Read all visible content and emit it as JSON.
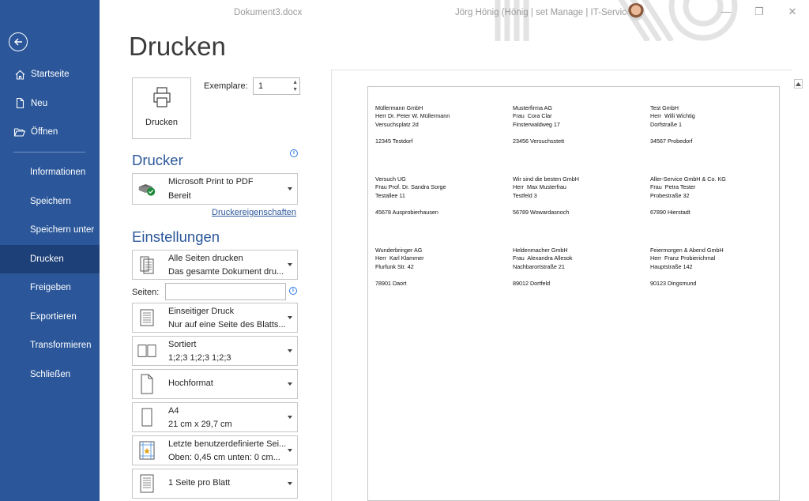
{
  "titlebar": {
    "document": "Dokument3.docx",
    "user": "Jörg Hönig (Hönig | set Manage | IT-Service)",
    "minimize": "—",
    "restore": "❐",
    "close": "✕"
  },
  "sidebar": {
    "top_items": [
      {
        "label": "Startseite",
        "icon": "home-icon"
      },
      {
        "label": "Neu",
        "icon": "new-document-icon"
      },
      {
        "label": "Öffnen",
        "icon": "folder-open-icon"
      }
    ],
    "bottom_items": [
      {
        "label": "Informationen"
      },
      {
        "label": "Speichern"
      },
      {
        "label": "Speichern unter"
      },
      {
        "label": "Drucken",
        "active": true
      },
      {
        "label": "Freigeben"
      },
      {
        "label": "Exportieren"
      },
      {
        "label": "Transformieren"
      },
      {
        "label": "Schließen"
      }
    ]
  },
  "print": {
    "title": "Drucken",
    "button_label": "Drucken",
    "copies_label": "Exemplare:",
    "copies_value": "1",
    "printer_heading": "Drucker",
    "printer_name": "Microsoft Print to PDF",
    "printer_status": "Bereit",
    "printer_properties": "Druckereigenschaften",
    "settings_heading": "Einstellungen",
    "pages_label": "Seiten:",
    "pages_value": "",
    "settings": [
      {
        "line1": "Alle Seiten drucken",
        "line2": "Das gesamte Dokument dru...",
        "icon": "pages-icon"
      },
      {
        "line1": "Einseitiger Druck",
        "line2": "Nur auf eine Seite des Blatts...",
        "icon": "one-sided-icon"
      },
      {
        "line1": "Sortiert",
        "line2": "1;2;3    1;2;3    1;2;3",
        "icon": "collated-icon"
      },
      {
        "line1": "Hochformat",
        "line2": "",
        "icon": "portrait-icon"
      },
      {
        "line1": "A4",
        "line2": "21 cm x 29,7 cm",
        "icon": "paper-size-icon"
      },
      {
        "line1": "Letzte benutzerdefinierte Sei...",
        "line2": "Oben: 0,45 cm unten: 0 cm...",
        "icon": "margins-icon"
      },
      {
        "line1": "1 Seite pro Blatt",
        "line2": "",
        "icon": "pages-per-sheet-icon"
      }
    ]
  },
  "preview": {
    "labels": [
      {
        "lines": [
          "Müllermann GmbH",
          "Herr Dr. Peter W. Müllermann",
          "Versuchsplatz 2d",
          "",
          "12345 Testdorf"
        ]
      },
      {
        "lines": [
          "Musterfirma AG",
          "Frau  Cora Clar",
          "Finsterwaldweg 17",
          "",
          "23456 Versuchsstett"
        ]
      },
      {
        "lines": [
          "Test GmbH",
          "Herr  Willi Wichtig",
          "Dorfstraße 1",
          "",
          "34567 Probedorf"
        ]
      },
      {
        "lines": [
          "Versuch UG",
          "Frau Prof. Dr. Sandra Sorge",
          "Testallee 11",
          "",
          "45678 Ausprobierhausen"
        ]
      },
      {
        "lines": [
          "Wir sind die besten GmbH",
          "Herr  Max Musterfrau",
          "Testfeld 3",
          "",
          "56789 Wowardasnoch"
        ]
      },
      {
        "lines": [
          "Aller-Service GmbH & Co. KG",
          "Frau  Petra Tester",
          "Probestraße 32",
          "",
          "67890 Hierstadt"
        ]
      },
      {
        "lines": [
          "Wunderbringer AG",
          "Herr  Karl Klammer",
          "Flurfunk Str. 42",
          "",
          "78901 Daort"
        ]
      },
      {
        "lines": [
          "Heldenmacher GmbH",
          "Frau  Alexandra Allesok",
          "Nachbarortstraße 21",
          "",
          "89012 Dortfeld"
        ]
      },
      {
        "lines": [
          "Feiermorgen & Abend GmbH",
          "Herr  Franz Probierichmal",
          "Hauptstraße 142",
          "",
          "90123 Dingsmund"
        ]
      }
    ]
  },
  "colors": {
    "sidebar": "#2b579a",
    "sidebar_active": "#1e4079",
    "accent": "#2b579a"
  }
}
